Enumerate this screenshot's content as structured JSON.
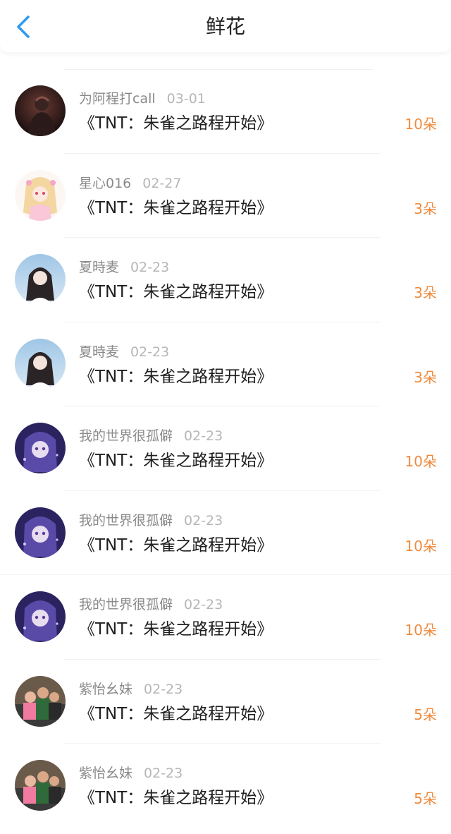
{
  "header": {
    "title": "鲜花",
    "back_icon": "chevron-left-icon",
    "accent": "#2f9bf0"
  },
  "colors": {
    "count": "#f08a3c",
    "name": "#8a8a8a",
    "date": "#b6b6b6"
  },
  "items": [
    {
      "name": "为阿程打call",
      "date": "03-01",
      "book": "《TNT：朱雀之路程开始》",
      "count": "10朵",
      "avatar": "dark-portrait"
    },
    {
      "name": "星心016",
      "date": "02-27",
      "book": "《TNT：朱雀之路程开始》",
      "count": "3朵",
      "avatar": "anime-girl-pink"
    },
    {
      "name": "夏時麦",
      "date": "02-23",
      "book": "《TNT：朱雀之路程开始》",
      "count": "3朵",
      "avatar": "girl-photo"
    },
    {
      "name": "夏時麦",
      "date": "02-23",
      "book": "《TNT：朱雀之路程开始》",
      "count": "3朵",
      "avatar": "girl-photo"
    },
    {
      "name": "我的世界很孤僻",
      "date": "02-23",
      "book": "《TNT：朱雀之路程开始》",
      "count": "10朵",
      "avatar": "anime-girl-purple"
    },
    {
      "name": "我的世界很孤僻",
      "date": "02-23",
      "book": "《TNT：朱雀之路程开始》",
      "count": "10朵",
      "avatar": "anime-girl-purple"
    },
    {
      "name": "我的世界很孤僻",
      "date": "02-23",
      "book": "《TNT：朱雀之路程开始》",
      "count": "10朵",
      "avatar": "anime-girl-purple"
    },
    {
      "name": "紫怡幺妹",
      "date": "02-23",
      "book": "《TNT：朱雀之路程开始》",
      "count": "5朵",
      "avatar": "kids-photo"
    },
    {
      "name": "紫怡幺妹",
      "date": "02-23",
      "book": "《TNT：朱雀之路程开始》",
      "count": "5朵",
      "avatar": "kids-photo"
    }
  ]
}
